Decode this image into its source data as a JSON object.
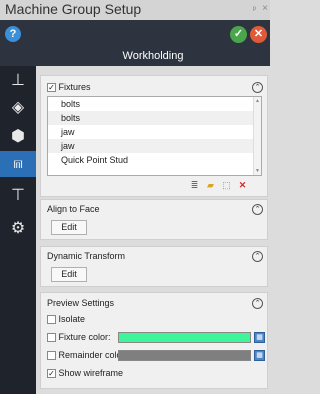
{
  "window": {
    "title": "Machine Group Setup",
    "pin_glyph": "ᵖ",
    "close_glyph": "×"
  },
  "header": {
    "title": "Workholding",
    "help_glyph": "?",
    "ok_glyph": "✓",
    "cancel_glyph": "✕"
  },
  "sidebar": {
    "items": [
      {
        "icon": "machine-icon",
        "glyph": "⊥"
      },
      {
        "icon": "stock-icon",
        "glyph": "◈"
      },
      {
        "icon": "part-icon",
        "glyph": "⬢"
      },
      {
        "icon": "workholding-icon",
        "glyph": "⩎"
      },
      {
        "icon": "tool-icon",
        "glyph": "⊤"
      },
      {
        "icon": "settings-icon",
        "glyph": "⚙"
      }
    ]
  },
  "fixtures": {
    "checkbox_label": "Fixtures",
    "checked": true,
    "items": [
      "bolts",
      "bolts",
      "jaw",
      "jaw",
      "Quick Point Stud"
    ],
    "tools": [
      "fixture-library-icon",
      "open-folder-icon",
      "select-icon",
      "delete-icon"
    ]
  },
  "align_to_face": {
    "title": "Align to Face",
    "edit_label": "Edit"
  },
  "dynamic_transform": {
    "title": "Dynamic Transform",
    "edit_label": "Edit"
  },
  "preview": {
    "title": "Preview Settings",
    "isolate_label": "Isolate",
    "fixture_color_label": "Fixture color:",
    "fixture_color": "#3ef59a",
    "remainder_color_label": "Remainder color:",
    "remainder_color": "#7f7f7f",
    "show_wireframe_label": "Show wireframe",
    "show_wireframe_checked": true
  }
}
